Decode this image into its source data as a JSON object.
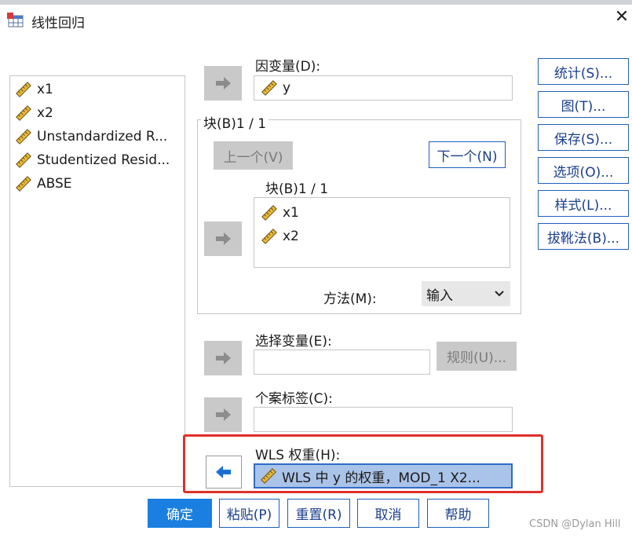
{
  "window": {
    "title": "线性回归",
    "close_icon": "close-icon"
  },
  "variables": [
    "x1",
    "x2",
    "Unstandardized R...",
    "Studentized Resid...",
    "ABSE"
  ],
  "dependent": {
    "label": "因变量(D):",
    "value": "y"
  },
  "block": {
    "header": "块(B)1 / 1",
    "prev_label": "上一个(V)",
    "next_label": "下一个(N)",
    "inner_header": "块(B)1 / 1",
    "independents": [
      "x1",
      "x2"
    ],
    "method_label": "方法(M):",
    "method_value": "输入"
  },
  "selection": {
    "label": "选择变量(E):",
    "rule_label": "规则(U)..."
  },
  "case_labels": {
    "label": "个案标签(C):"
  },
  "wls": {
    "label": "WLS 权重(H):",
    "value": "WLS 中 y 的权重，MOD_1 X2..."
  },
  "side_buttons": [
    "统计(S)...",
    "图(T)...",
    "保存(S)...",
    "选项(O)...",
    "样式(L)...",
    "拔靴法(B)..."
  ],
  "bottom_buttons": {
    "ok": "确定",
    "paste": "粘贴(P)",
    "reset": "重置(R)",
    "cancel": "取消",
    "help": "帮助"
  },
  "watermark": "CSDN @Dylan  Hill",
  "colors": {
    "accent": "#1a7fe0",
    "highlight": "#e0302a",
    "selected_field": "#aac3e8"
  }
}
